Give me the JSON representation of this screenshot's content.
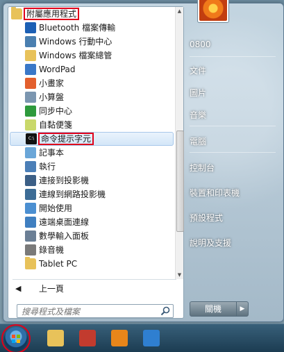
{
  "programs": {
    "folder": "附屬應用程式",
    "items": [
      {
        "label": "Bluetooth 檔案傳輸",
        "icon": "bluetooth-icon",
        "color": "#1c5fb4"
      },
      {
        "label": "Windows 行動中心",
        "icon": "mobility-center-icon",
        "color": "#4a7fb0"
      },
      {
        "label": "Windows 檔案總管",
        "icon": "explorer-folder-icon",
        "color": "#e8c25a"
      },
      {
        "label": "WordPad",
        "icon": "wordpad-icon",
        "color": "#3a78c8"
      },
      {
        "label": "小畫家",
        "icon": "paint-icon",
        "color": "#e35f2d"
      },
      {
        "label": "小算盤",
        "icon": "calculator-icon",
        "color": "#7b96b0"
      },
      {
        "label": "同步中心",
        "icon": "sync-center-icon",
        "color": "#2e9a3c"
      },
      {
        "label": "自黏便箋",
        "icon": "sticky-notes-icon",
        "color": "#c9d86a"
      },
      {
        "label": "命令提示字元",
        "icon": "command-prompt-icon",
        "color": "#111111",
        "selected": true
      },
      {
        "label": "記事本",
        "icon": "notepad-icon",
        "color": "#6aa6d8"
      },
      {
        "label": "執行",
        "icon": "run-icon",
        "color": "#4b7fb7"
      },
      {
        "label": "連接到投影機",
        "icon": "projector-icon",
        "color": "#3c5f86"
      },
      {
        "label": "連線到網路投影機",
        "icon": "network-projector-icon",
        "color": "#3c6c96"
      },
      {
        "label": "開始使用",
        "icon": "getting-started-icon",
        "color": "#4b8fd1"
      },
      {
        "label": "遠端桌面連線",
        "icon": "remote-desktop-icon",
        "color": "#3f7fc0"
      },
      {
        "label": "數學輸入面板",
        "icon": "math-input-icon",
        "color": "#6b7f95"
      },
      {
        "label": "錄音機",
        "icon": "microphone-icon",
        "color": "#7a7a7a"
      },
      {
        "label": "Tablet PC",
        "icon": "folder-icon",
        "color": "#e8c25a"
      }
    ],
    "back_label": "上一頁"
  },
  "search": {
    "placeholder": "搜尋程式及檔案"
  },
  "right_pane": {
    "items": [
      "0800",
      "文件",
      "圖片",
      "音樂",
      "電腦",
      "控制台",
      "裝置和印表機",
      "預設程式",
      "說明及支援"
    ]
  },
  "shutdown": {
    "label": "關機"
  },
  "taskbar": {
    "buttons": [
      {
        "name": "explorer-taskbar-icon",
        "color": "#e8c25a"
      },
      {
        "name": "media-center-taskbar-icon",
        "color": "#c23b2e"
      },
      {
        "name": "media-player-taskbar-icon",
        "color": "#e8861a"
      },
      {
        "name": "internet-explorer-taskbar-icon",
        "color": "#2f7fd0"
      }
    ]
  }
}
